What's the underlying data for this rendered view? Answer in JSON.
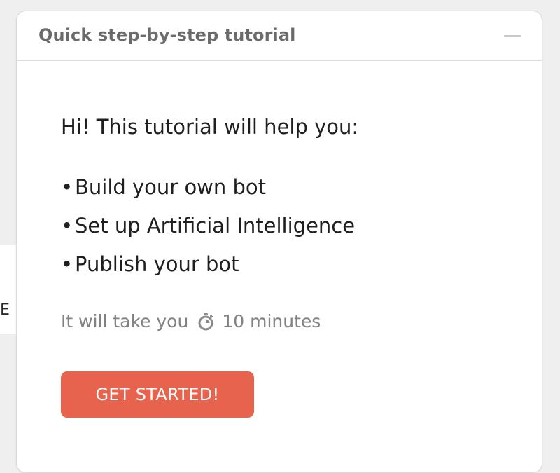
{
  "backdrop": {
    "partial_letter": "E"
  },
  "panel": {
    "title": "Quick step-by-step tutorial",
    "intro": "Hi! This tutorial will help you:",
    "bullet_symbol": "•",
    "items": [
      {
        "label": "Build your own bot"
      },
      {
        "label": "Set up Artificial Intelligence"
      },
      {
        "label": "Publish your bot"
      }
    ],
    "duration_prefix": "It will take you",
    "duration_value": "10 minutes",
    "timer_icon": "stopwatch-icon",
    "cta_label": "GET STARTED!"
  },
  "colors": {
    "accent": "#e8634e",
    "title": "#6b6b6b",
    "muted": "#828282",
    "text": "#1f1f1f"
  }
}
